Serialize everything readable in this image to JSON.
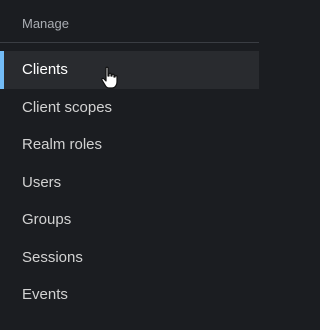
{
  "section": {
    "title": "Manage"
  },
  "nav": {
    "items": [
      {
        "label": "Clients",
        "active": true
      },
      {
        "label": "Client scopes",
        "active": false
      },
      {
        "label": "Realm roles",
        "active": false
      },
      {
        "label": "Users",
        "active": false
      },
      {
        "label": "Groups",
        "active": false
      },
      {
        "label": "Sessions",
        "active": false
      },
      {
        "label": "Events",
        "active": false
      }
    ]
  },
  "colors": {
    "background": "#1b1d21",
    "active_background": "#292b2f",
    "active_indicator": "#73bcf7",
    "text": "#d2d2d2",
    "header_text": "#a9adb3"
  },
  "cursor": {
    "icon": "hand-pointer-icon"
  }
}
